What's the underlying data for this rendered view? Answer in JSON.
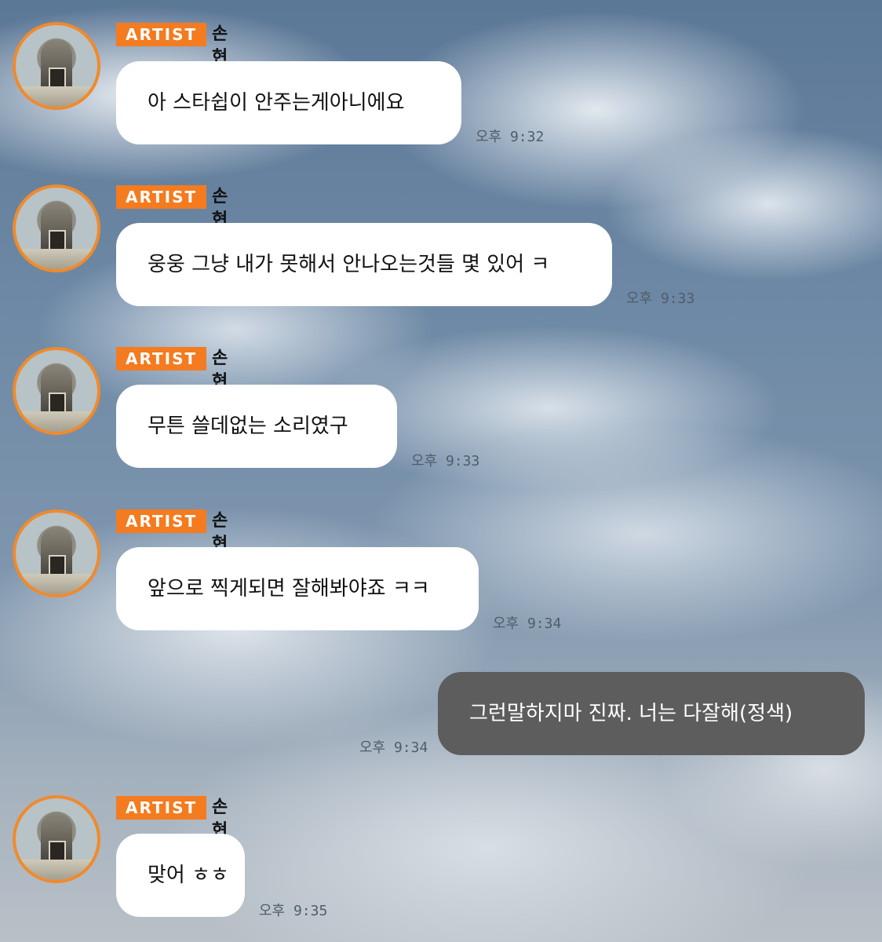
{
  "messages": [
    {
      "badge": "ARTIST",
      "sender": "손현우",
      "text": "아 스타쉽이 안주는게아니에요",
      "time": "오후 9:32"
    },
    {
      "badge": "ARTIST",
      "sender": "손현우",
      "text": "웅웅 그냥 내가 못해서 안나오는것들 몇 있어 ㅋ",
      "time": "오후 9:33"
    },
    {
      "badge": "ARTIST",
      "sender": "손현우",
      "text": "무튼 쓸데없는 소리였구",
      "time": "오후 9:33"
    },
    {
      "badge": "ARTIST",
      "sender": "손현우",
      "text": "앞으로 찍게되면 잘해봐야죠 ㅋㅋ",
      "time": "오후 9:34"
    },
    {
      "text": "그런말하지마 진짜.  너는 다잘해(정색)",
      "time": "오후 9:34"
    },
    {
      "badge": "ARTIST",
      "sender": "손현우",
      "text": "맞어 ㅎㅎ",
      "time": "오후 9:35"
    }
  ]
}
